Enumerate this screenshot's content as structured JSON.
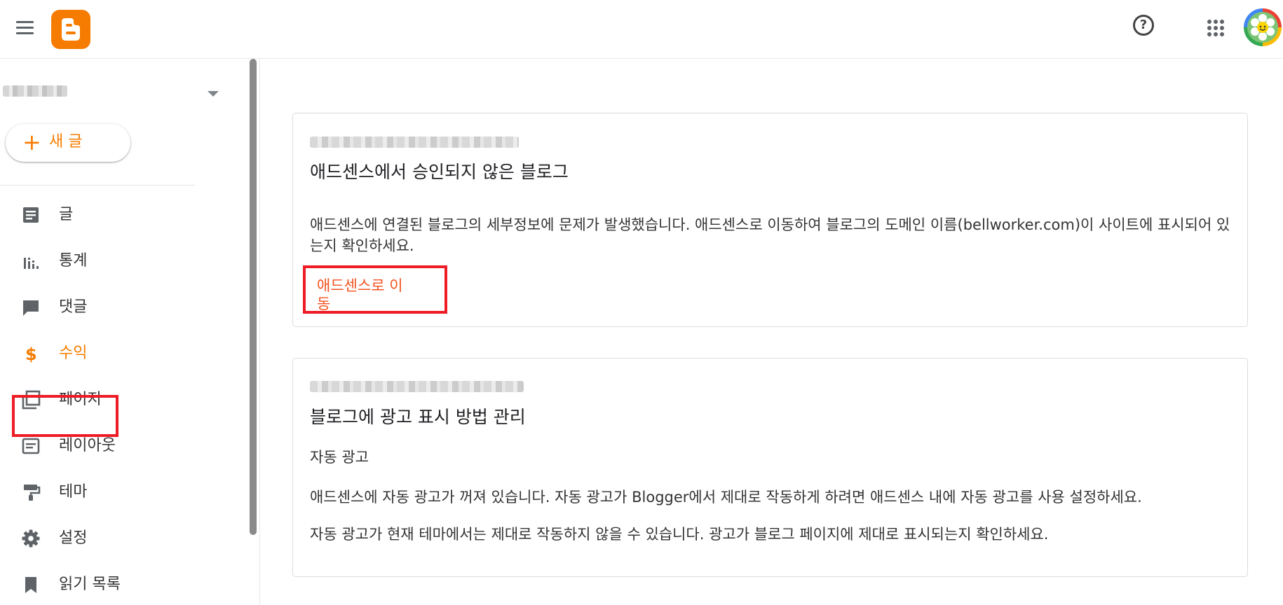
{
  "header": {
    "menu_icon": "hamburger-menu-icon",
    "logo_icon": "blogger-logo-icon",
    "help_icon": "help-circle-icon",
    "help_glyph": "?",
    "apps_icon": "apps-grid-icon",
    "avatar_icon": "account-avatar",
    "colors": {
      "brand": "#f57c00"
    }
  },
  "sidebar": {
    "new_post_label": "새 글",
    "items": [
      {
        "label": "글",
        "icon": "posts-icon"
      },
      {
        "label": "통계",
        "icon": "stats-icon"
      },
      {
        "label": "댓글",
        "icon": "comments-icon"
      },
      {
        "label": "수익",
        "icon": "dollar-icon",
        "active": true
      },
      {
        "label": "페이지",
        "icon": "pages-icon"
      },
      {
        "label": "레이아웃",
        "icon": "layout-icon"
      },
      {
        "label": "테마",
        "icon": "theme-paint-roller-icon"
      },
      {
        "label": "설정",
        "icon": "settings-gear-icon"
      },
      {
        "label": "읽기 목록",
        "icon": "bookmark-icon"
      }
    ]
  },
  "main": {
    "cards": [
      {
        "title": "애드센스에서 승인되지 않은 블로그",
        "body": "애드센스에 연결된 블로그의 세부정보에 문제가 발생했습니다. 애드센스로 이동하여 블로그의 도메인 이름(bellworker.com)이 사이트에 표시되어 있는지 확인하세요.",
        "action_label": "애드센스로 이동"
      },
      {
        "title": "블로그에 광고 표시 방법 관리",
        "subtitle": "자동 광고",
        "body_1": "애드센스에 자동 광고가 꺼져 있습니다. 자동 광고가 Blogger에서 제대로 작동하게 하려면 애드센스 내에 자동 광고를 사용 설정하세요.",
        "body_2": "자동 광고가 현재 테마에서는 제대로 작동하지 않을 수 있습니다. 광고가 블로그 페이지에 제대로 표시되는지 확인하세요."
      }
    ],
    "colors": {
      "link": "#f4511e",
      "highlight": "#ee1c25"
    }
  }
}
